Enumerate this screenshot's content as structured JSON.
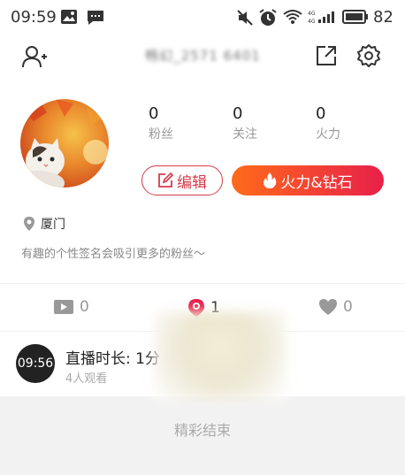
{
  "status_bar": {
    "time": "09:59",
    "battery_percent": "82",
    "icons": [
      "image-icon",
      "message-icon",
      "mute-icon",
      "alarm-icon",
      "wifi-icon",
      "signal-icon",
      "battery-icon"
    ]
  },
  "header": {
    "add_user_icon": "add-user-icon",
    "username_blurred": "畅幻_2571 6401",
    "share_icon": "share-icon",
    "settings_icon": "gear-icon"
  },
  "profile": {
    "stats": [
      {
        "value": "0",
        "label": "粉丝"
      },
      {
        "value": "0",
        "label": "关注"
      },
      {
        "value": "0",
        "label": "火力"
      }
    ],
    "edit_label": "编辑",
    "fire_label": "火力&钻石",
    "location": "厦门",
    "signature": "有趣的个性签名会吸引更多的粉丝～"
  },
  "tabs": [
    {
      "icon": "video-icon",
      "count": "0"
    },
    {
      "icon": "live-pin-icon",
      "count": "1"
    },
    {
      "icon": "heart-icon",
      "count": "0"
    }
  ],
  "live_item": {
    "duration": "09:56",
    "title": "直播时长: 1分",
    "viewers": "4人观看"
  },
  "footer": {
    "text": "精彩结束"
  },
  "colors": {
    "accent_red": "#d63a4a",
    "fire_gradient_start": "#ff6b1a",
    "fire_gradient_end": "#e8204a"
  }
}
